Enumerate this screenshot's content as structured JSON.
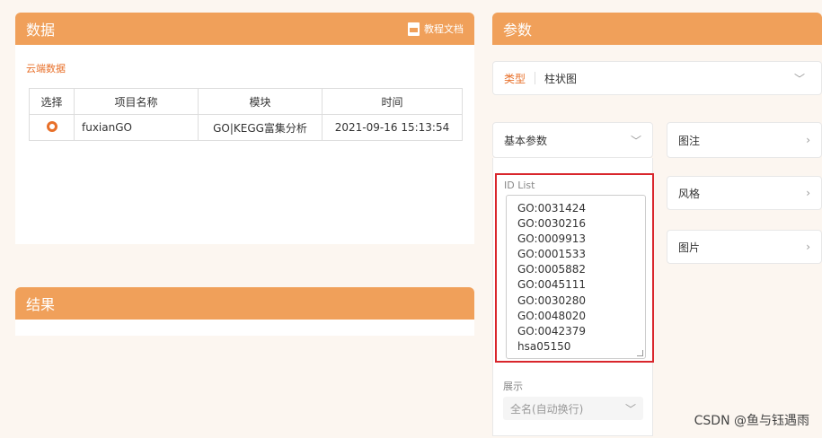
{
  "data_panel": {
    "title": "数据",
    "doc_link": "教程文档",
    "source_label": "云端数据",
    "table": {
      "headers": [
        "选择",
        "项目名称",
        "模块",
        "时间"
      ],
      "rows": [
        {
          "name": "fuxianGO",
          "module": "GO|KEGG富集分析",
          "time": "2021-09-16 15:13:54"
        }
      ]
    }
  },
  "result_panel": {
    "title": "结果"
  },
  "params_panel": {
    "title": "参数",
    "type_label": "类型",
    "type_value": "柱状图",
    "basic_params": "基本参数",
    "id_list_label": "ID List",
    "id_list": [
      "GO:0031424",
      "GO:0030216",
      "GO:0009913",
      "GO:0001533",
      "GO:0005882",
      "GO:0045111",
      "GO:0030280",
      "GO:0048020",
      "GO:0042379",
      "hsa05150"
    ],
    "display_label": "展示",
    "display_value": "全名(自动换行)",
    "side_tabs": [
      "图注",
      "风格",
      "图片"
    ]
  },
  "watermark": "CSDN @鱼与钰遇雨",
  "colors": {
    "accent": "#f0a05a",
    "link": "#e8702a",
    "highlight_border": "#d9262c"
  }
}
